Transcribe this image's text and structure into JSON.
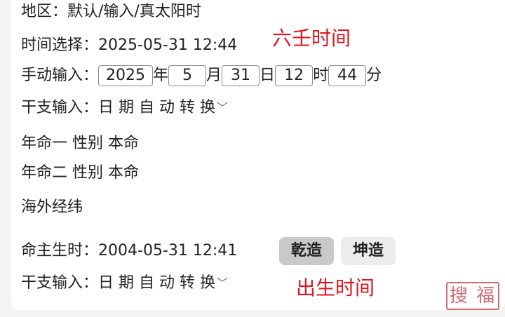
{
  "region": {
    "label": "地区：",
    "value": "默认/输入/真太阳时"
  },
  "time_select": {
    "label": "时间选择：",
    "value": "2025-05-31 12:44"
  },
  "annotation_liuren": "六壬时间",
  "manual": {
    "label": "手动输入：",
    "year": "2025",
    "year_unit": "年",
    "month": "5",
    "month_unit": "月",
    "day": "31",
    "day_unit": "日",
    "hour": "12",
    "hour_unit": "时",
    "minute": "44",
    "minute_unit": "分"
  },
  "ganzhi1": {
    "label": "干支输入：",
    "value": "日 期 自 动 转 换",
    "chevron": "﹀"
  },
  "nianming1": "年命一 性别 本命",
  "nianming2": "年命二 性别 本命",
  "overseas": "海外经纬",
  "birth": {
    "label": "命主生时：",
    "value": "2004-05-31 12:41"
  },
  "buttons": {
    "qian": "乾造",
    "kun": "坤造"
  },
  "ganzhi2": {
    "label": "干支输入：",
    "value": "日 期 自 动 转 换",
    "chevron": "﹀"
  },
  "annotation_birth": "出生时间",
  "seal_text": "搜 福"
}
